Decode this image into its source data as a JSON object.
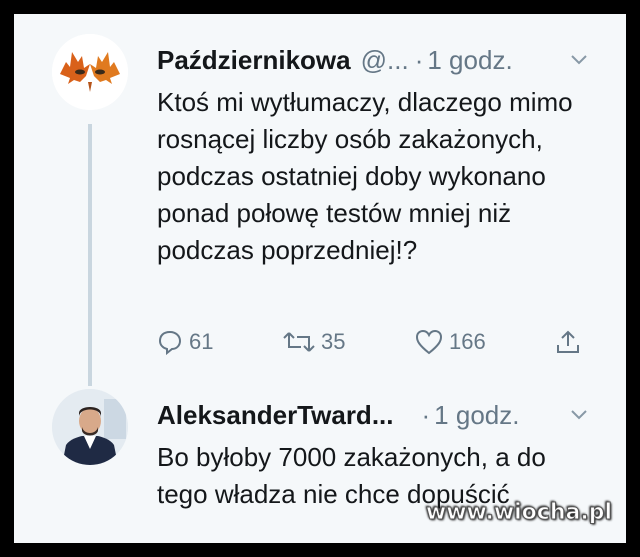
{
  "tweets": [
    {
      "author_name": "Październikowa",
      "handle": "@...",
      "separator": "·",
      "time": "1 godz.",
      "text": "Ktoś mi wytłumaczy, dlaczego mimo rosnącej liczby osób zakażonych, podczas ostatniej doby wykonano ponad połowę testów mniej niż podczas poprzedniej!?",
      "replies": "61",
      "retweets": "35",
      "likes": "166"
    },
    {
      "author_name": "AleksanderTward...",
      "separator": "·",
      "time": "1 godz.",
      "text": "Bo byłoby 7000 zakażonych, a do tego władza nie chce dopuścić"
    }
  ],
  "watermark": "www.wiocha.pl",
  "colors": {
    "background": "#f5f8fa",
    "text": "#14171a",
    "secondary": "#657786",
    "thread_line": "#c9d6df"
  }
}
